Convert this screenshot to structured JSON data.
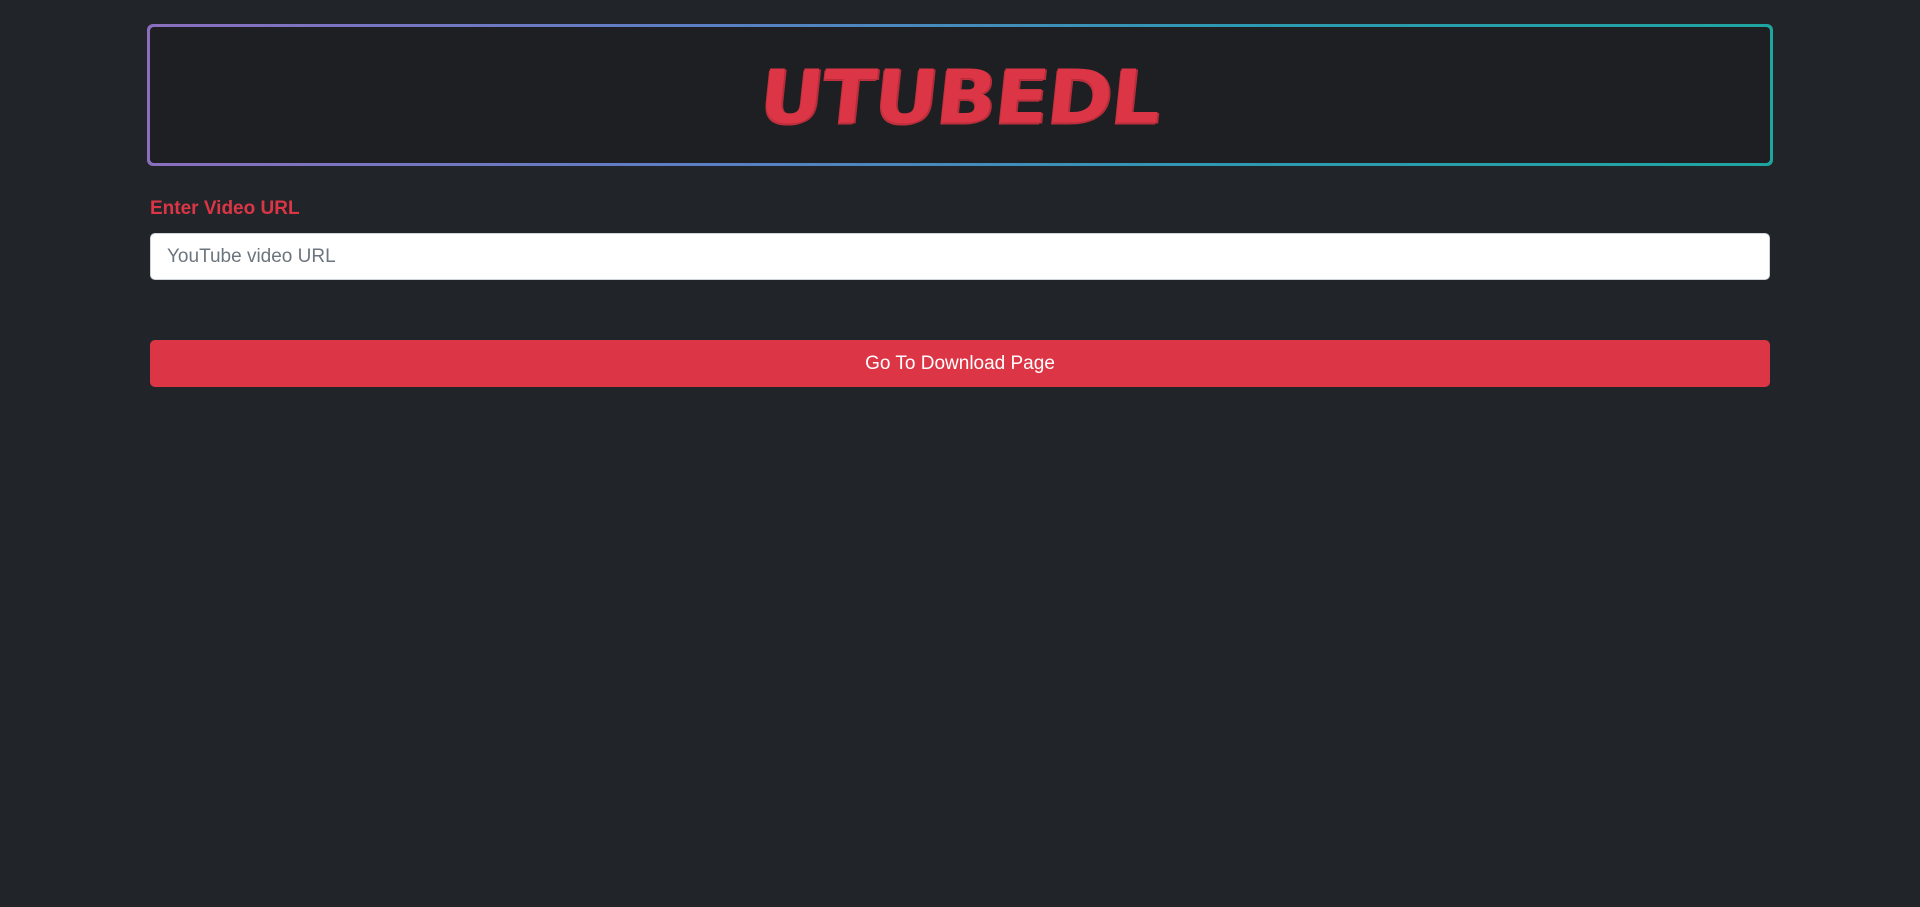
{
  "header": {
    "logo_text": "UTUBEDL"
  },
  "form": {
    "label": "Enter Video URL",
    "input_value": "",
    "input_placeholder": "YouTube video URL",
    "submit_label": "Go To Download Page"
  },
  "colors": {
    "background": "#212529",
    "accent": "#dc3545",
    "header_border_start": "#8b6fbf",
    "header_border_end": "#1fa5a0"
  }
}
